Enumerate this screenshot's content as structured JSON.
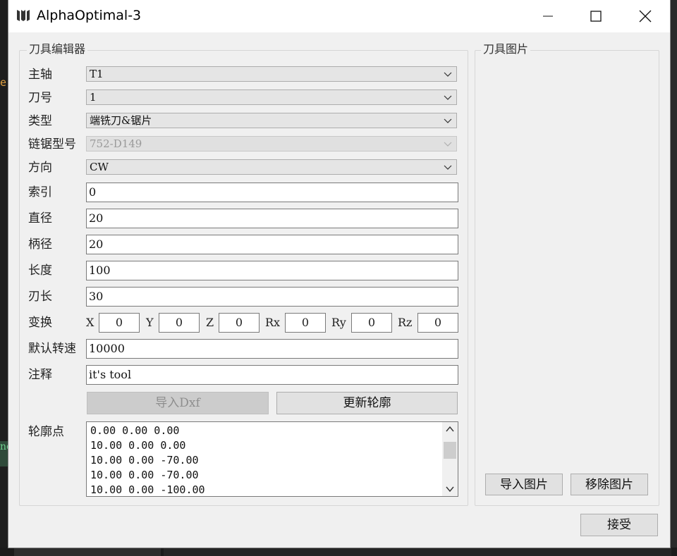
{
  "window": {
    "title": "AlphaOptimal-3"
  },
  "background": {
    "edge_text": "e.",
    "edge_green": "ne"
  },
  "editor": {
    "group_title": "刀具编辑器",
    "spindle": {
      "label": "主轴",
      "value": "T1"
    },
    "tool_number": {
      "label": "刀号",
      "value": "1"
    },
    "type": {
      "label": "类型",
      "value": "端铣刀&锯片"
    },
    "chainsaw_model": {
      "label": "链锯型号",
      "value": "752-D149"
    },
    "direction": {
      "label": "方向",
      "value": "CW"
    },
    "index": {
      "label": "索引",
      "value": "0"
    },
    "diameter": {
      "label": "直径",
      "value": "20"
    },
    "shank_diameter": {
      "label": "柄径",
      "value": "20"
    },
    "length": {
      "label": "长度",
      "value": "100"
    },
    "blade_length": {
      "label": "刃长",
      "value": "30"
    },
    "transform": {
      "label": "变换",
      "x_label": "X",
      "x": "0",
      "y_label": "Y",
      "y": "0",
      "z_label": "Z",
      "z": "0",
      "rx_label": "Rx",
      "rx": "0",
      "ry_label": "Ry",
      "ry": "0",
      "rz_label": "Rz",
      "rz": "0"
    },
    "default_speed": {
      "label": "默认转速",
      "value": "10000"
    },
    "comment": {
      "label": "注释",
      "value": "it's tool"
    },
    "import_dxf_label": "导入Dxf",
    "update_profile_label": "更新轮廓",
    "profile_points": {
      "label": "轮廓点",
      "lines": [
        "0.00 0.00 0.00",
        "10.00 0.00 0.00",
        "10.00 0.00 -70.00",
        "10.00 0.00 -70.00",
        "10.00 0.00 -100.00"
      ]
    }
  },
  "picture": {
    "group_title": "刀具图片",
    "import_label": "导入图片",
    "remove_label": "移除图片"
  },
  "accept_label": "接受",
  "icons": {
    "app": "alpha-logo-icon",
    "minimize": "minimize-icon",
    "maximize": "maximize-icon",
    "close": "close-icon",
    "dropdown": "chevron-down-icon"
  }
}
